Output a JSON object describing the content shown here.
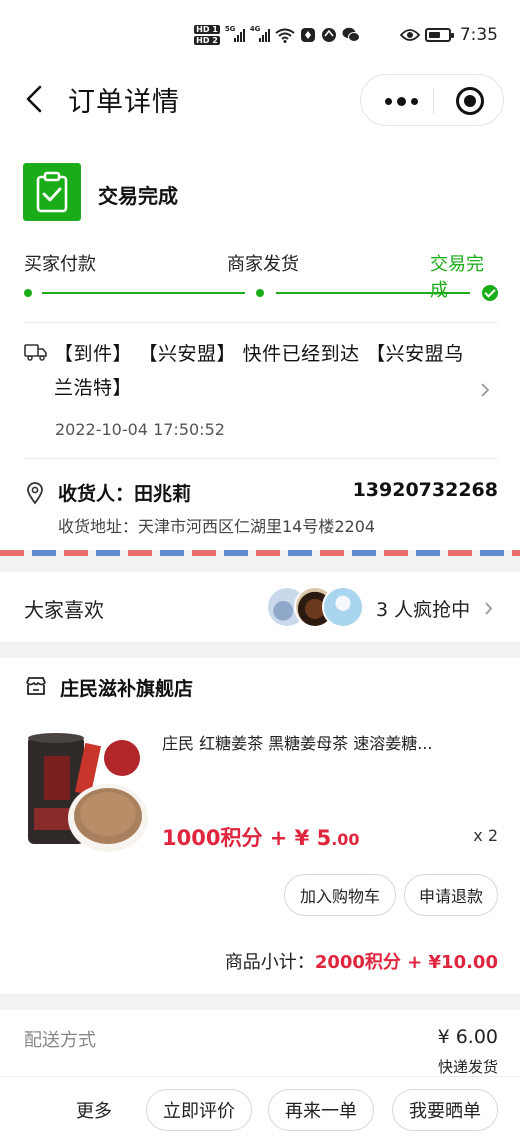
{
  "status_bar": {
    "network_badges": [
      "HD 1",
      "HD 2"
    ],
    "signal_1_label": "5G",
    "signal_2_label": "4G",
    "time": "7:35",
    "battery_level": 0.6,
    "icons": [
      "hd-icon",
      "signal-icon",
      "wifi-icon",
      "app-notification-icon",
      "wechat-icon",
      "eye-icon",
      "battery-icon"
    ]
  },
  "header": {
    "title": "订单详情",
    "back_icon": "chevron-left-icon",
    "capsule_icons": [
      "more-dots-icon",
      "record-icon"
    ]
  },
  "order_status": {
    "status_text": "交易完成",
    "status_icon": "clipboard-check-icon",
    "accent_color": "#1aad19",
    "steps": [
      {
        "label": "买家付款"
      },
      {
        "label": "商家发货"
      },
      {
        "label": "交易完成"
      }
    ]
  },
  "logistics": {
    "icon": "truck-icon",
    "text": "【到件】 【兴安盟】 快件已经到达 【兴安盟乌兰浩特】",
    "time": "2022-10-04 17:50:52"
  },
  "address": {
    "icon": "location-pin-icon",
    "receiver": "收货人：田兆莉",
    "phone": "13920732268",
    "address": "收货地址：天津市河西区仁湖里14号楼2204"
  },
  "popular": {
    "label": "大家喜欢",
    "count_text": "3 人疯抢中"
  },
  "shop": {
    "name": "庄民滋补旗舰店",
    "icon": "shop-icon",
    "product": {
      "title": "庄民 红糖姜茶 黑糖姜母茶 速溶姜糖...",
      "price_points": "1000积分 + ¥ 5",
      "price_cents": ".00",
      "quantity": "x 2"
    },
    "buttons": {
      "add_to_cart": "加入购物车",
      "refund": "申请退款"
    },
    "subtotal_label": "商品小计：",
    "subtotal_value": "2000积分 + ¥10.00",
    "price_color": "#e0263f"
  },
  "delivery": {
    "label": "配送方式",
    "fee": "¥ 6.00",
    "method": "快递发货"
  },
  "bottom_bar": {
    "more": "更多",
    "review": "立即评价",
    "reorder": "再来一单",
    "share": "我要晒单"
  }
}
